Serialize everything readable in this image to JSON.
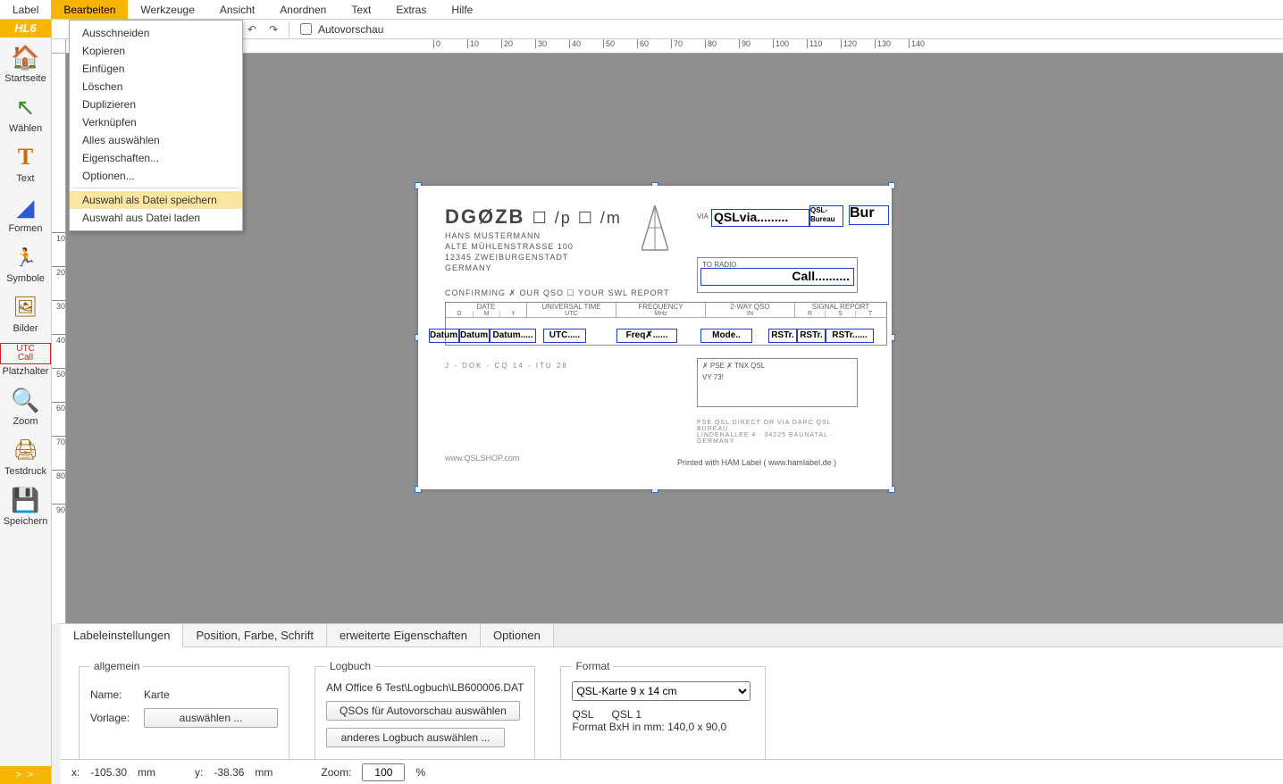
{
  "menu": {
    "items": [
      {
        "label": "Label"
      },
      {
        "label": "Bearbeiten"
      },
      {
        "label": "Werkzeuge"
      },
      {
        "label": "Ansicht"
      },
      {
        "label": "Anordnen"
      },
      {
        "label": "Text"
      },
      {
        "label": "Extras"
      },
      {
        "label": "Hilfe"
      }
    ],
    "active_index": 1
  },
  "dropdown": {
    "items": [
      "Ausschneiden",
      "Kopieren",
      "Einfügen",
      "Löschen",
      "Duplizieren",
      "Verknüpfen",
      "Alles auswählen",
      "Eigenschaften...",
      "Optionen...",
      "Auswahl als Datei speichern",
      "Auswahl aus Datei laden"
    ],
    "highlight_index": 9
  },
  "sidebar": {
    "badge": "HL6",
    "tools": [
      {
        "label": "Startseite",
        "icon": "🏠"
      },
      {
        "label": "Wählen",
        "icon": "↖"
      },
      {
        "label": "Text",
        "icon": "T"
      },
      {
        "label": "Formen",
        "icon": "⬛"
      },
      {
        "label": "Symbole",
        "icon": "🏃"
      },
      {
        "label": "Bilder",
        "icon": "🖼"
      },
      {
        "label": "Platzhalter",
        "icon": "UTC"
      },
      {
        "label": "Zoom",
        "icon": "🔍"
      },
      {
        "label": "Testdruck",
        "icon": "🖨"
      },
      {
        "label": "Speichern",
        "icon": "💾"
      }
    ],
    "expander": "> >"
  },
  "toolrow": {
    "autovorschau": "Autovorschau"
  },
  "ruler": {
    "h": [
      "0",
      "10",
      "20",
      "30",
      "40",
      "50",
      "60",
      "70",
      "80",
      "90",
      "100",
      "110",
      "120",
      "130",
      "140"
    ],
    "v": [
      "10",
      "20",
      "30",
      "40",
      "50",
      "60",
      "70",
      "80",
      "90"
    ]
  },
  "card": {
    "callsign": "DGØZB",
    "pm": "☐ /p  ☐ /m",
    "addr": "HANS MUSTERMANN\nALTE MÜHLENSTRASSE 100\n12345 ZWEIBURGENSTADT\nGERMANY",
    "confirm": "CONFIRMING  ✗ OUR QSO  ☐ YOUR SWL REPORT",
    "footer_note": "J -    DOK -    CQ 14    -   ITU 28",
    "via_label": "VIA",
    "to_radio": "TO RADIO",
    "pse": "✗ PSE    ✗ TNX QSL",
    "vy73": "VY 73!",
    "bureau_note": "PSE QSL DIRECT OR VIA DARC QSL BUREAU\nLINDENALLEE 4 · 34225 BAUNATAL · GERMANY",
    "qslshop": "www.QSLSHOP.com",
    "printedwith": "Printed with HAM Label ( www.hamlabel.de )",
    "grid_hdr": {
      "date": "DATE",
      "d": "D",
      "m": "M",
      "y": "Y",
      "utc": "UNIVERSAL TIME",
      "utc2": "UTC",
      "freq": "FREQUENCY",
      "mhz": "MHz",
      "way": "2-WAY QSO",
      "in": "IN",
      "sig": "SIGNAL REPORT",
      "r": "R",
      "s": "S",
      "t": "T"
    },
    "ph": {
      "qslvia": "QSLvia.........",
      "qsl_bureau": "QSL-Bureau",
      "bur": "Bur",
      "call": "Call..........",
      "datum": "Datum.",
      "datum2": "Datum.",
      "datum3": "Datum.....",
      "utc": "UTC.....",
      "freq": "Freq✗......",
      "mode": "Mode..",
      "rstr1": "RSTr.",
      "rstr2": "RSTr.",
      "rstr3": "RSTr......"
    }
  },
  "props": {
    "tabs": [
      "Labeleinstellungen",
      "Position, Farbe, Schrift",
      "erweiterte Eigenschaften",
      "Optionen"
    ],
    "allgemein": {
      "legend": "allgemein",
      "name_lbl": "Name:",
      "name_val": "Karte",
      "vorlage_lbl": "Vorlage:",
      "vorlage_btn": "auswählen ..."
    },
    "logbuch": {
      "legend": "Logbuch",
      "path": "AM Office 6 Test\\Logbuch\\LB600006.DAT",
      "btn1": "QSOs für Autovorschau auswählen",
      "btn2": "anderes Logbuch auswählen ..."
    },
    "format": {
      "legend": "Format",
      "select": "QSL-Karte 9 x 14 cm",
      "line1a": "QSL",
      "line1b": "QSL 1",
      "line2": "Format BxH in mm: 140,0 x 90,0"
    }
  },
  "status": {
    "x_lbl": "x:",
    "x_val": "-105.30",
    "y_lbl": "y:",
    "y_val": "-38.36",
    "mm": "mm",
    "zoom_lbl": "Zoom:",
    "zoom_val": "100",
    "pct": "%"
  }
}
